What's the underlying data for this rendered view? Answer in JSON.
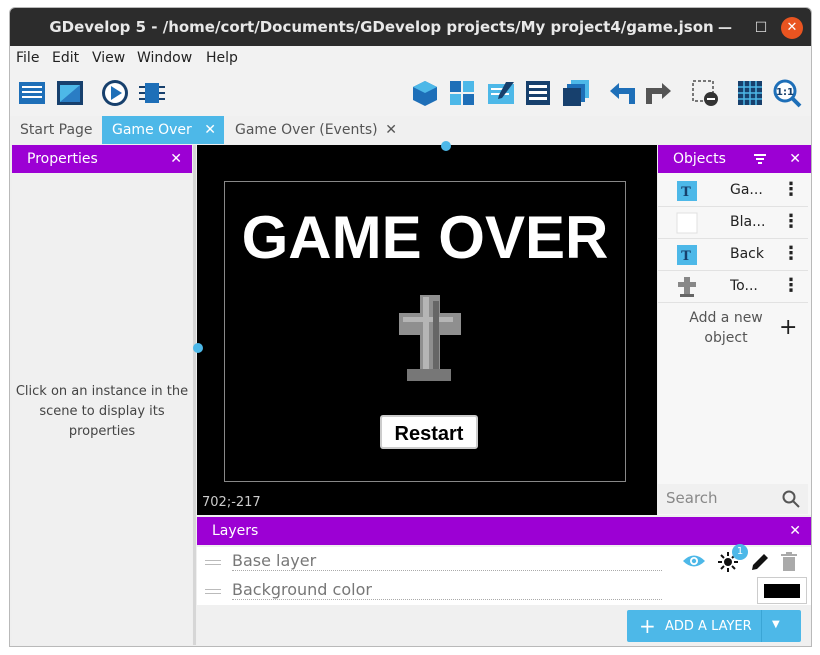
{
  "window": {
    "title": "GDevelop 5 - /home/cort/Documents/GDevelop projects/My project4/game.json",
    "close_glyph": "✕",
    "max_glyph": "☐",
    "min_glyph": "—"
  },
  "menu": [
    "File",
    "Edit",
    "View",
    "Window",
    "Help"
  ],
  "toolbar": {
    "icons": [
      "project-manager-icon",
      "scene-icon",
      "preview-icon",
      "debugger-icon",
      "object-icon",
      "object-groups-icon",
      "properties-icon",
      "instances-list-icon",
      "layers-icon",
      "undo-icon",
      "redo-icon",
      "delete-selection-icon",
      "grid-icon",
      "zoom-icon"
    ]
  },
  "tabs": [
    {
      "label": "Start Page",
      "closable": false
    },
    {
      "label": "Game Over",
      "closable": true,
      "active": true
    },
    {
      "label": "Game Over (Events)",
      "closable": true
    }
  ],
  "tab_close_glyph": "✕",
  "properties": {
    "title": "Properties",
    "close_glyph": "✕",
    "message": "Click on an instance in the scene to display its properties"
  },
  "scene": {
    "coords": "702;-217",
    "game_over_text": "GAME OVER",
    "restart_label": "Restart"
  },
  "objects": {
    "title": "Objects",
    "close_glyph": "✕",
    "items": [
      {
        "name": "Ga...",
        "icon": "text-object-icon"
      },
      {
        "name": "Bla...",
        "icon": "sprite-blank-icon"
      },
      {
        "name": "Back",
        "icon": "text-object-icon"
      },
      {
        "name": "To...",
        "icon": "tombstone-icon"
      }
    ],
    "more_glyph": "⋮",
    "add_label": "Add a new object",
    "add_glyph": "+",
    "search_placeholder": "Search"
  },
  "layers": {
    "title": "Layers",
    "close_glyph": "✕",
    "rows": [
      {
        "name": "Base layer"
      },
      {
        "name": "Background color"
      }
    ],
    "effects_count": "1",
    "add_label": "ADD A LAYER",
    "add_glyph": "+",
    "dropdown_glyph": "▼",
    "background_color": "#000000"
  },
  "colors": {
    "accent_blue": "#4db8e8",
    "panel_purple": "#9c00d4",
    "ubuntu_orange": "#e95420"
  }
}
